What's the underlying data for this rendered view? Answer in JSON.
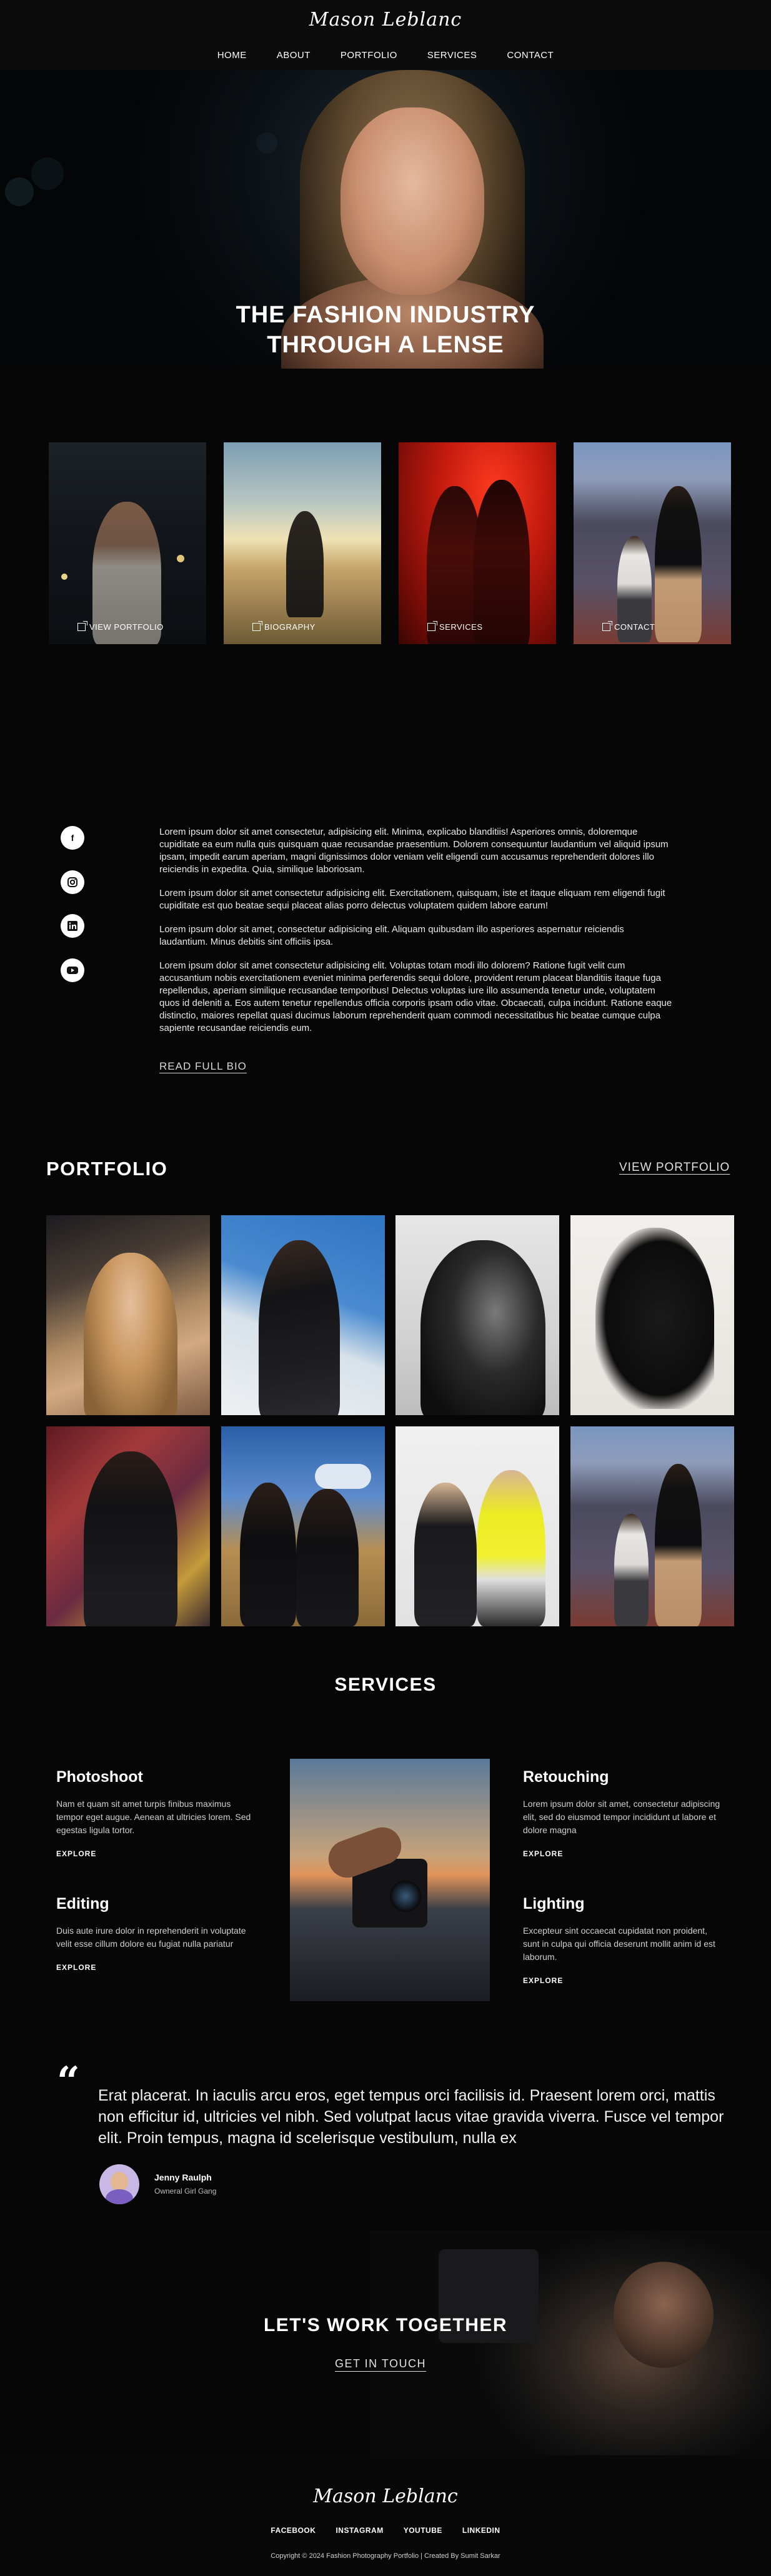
{
  "header": {
    "logo": "Mason Leblanc",
    "nav": [
      "HOME",
      "ABOUT",
      "PORTFOLIO",
      "SERVICES",
      "CONTACT"
    ]
  },
  "hero": {
    "title_line1": "THE FASHION INDUSTRY",
    "title_line2": "THROUGH A LENSE"
  },
  "cards": [
    {
      "label": "VIEW PORTFOLIO"
    },
    {
      "label": "BIOGRAPHY"
    },
    {
      "label": "SERVICES"
    },
    {
      "label": "CONTACT"
    }
  ],
  "bio": {
    "socials": [
      "facebook-icon",
      "instagram-icon",
      "linkedin-icon",
      "youtube-icon"
    ],
    "paragraphs": [
      "Lorem ipsum dolor sit amet consectetur, adipisicing elit. Minima, explicabo blanditiis! Asperiores omnis, doloremque cupiditate ea eum nulla quis quisquam quae recusandae praesentium. Dolorem consequuntur laudantium vel aliquid ipsum ipsam, impedit earum aperiam, magni dignissimos dolor veniam velit eligendi cum accusamus reprehenderit dolores illo reiciendis in expedita. Quia, similique laboriosam.",
      "Lorem ipsum dolor sit amet consectetur adipisicing elit. Exercitationem, quisquam, iste et itaque eliquam rem eligendi fugit cupiditate est quo beatae sequi placeat alias porro delectus voluptatem quidem labore earum!",
      "Lorem ipsum dolor sit amet, consectetur adipisicing elit. Aliquam quibusdam illo asperiores aspernatur reiciendis laudantium. Minus debitis sint officiis ipsa.",
      "Lorem ipsum dolor sit amet consectetur adipisicing elit. Voluptas totam modi illo dolorem? Ratione fugit velit cum accusantium nobis exercitationem eveniet minima perferendis sequi dolore, provident rerum placeat blanditiis itaque fuga repellendus, aperiam similique recusandae temporibus! Delectus voluptas iure illo assumenda tenetur unde, voluptatem quos id deleniti a. Eos autem tenetur repellendus officia corporis ipsam odio vitae. Obcaecati, culpa incidunt. Ratione eaque distinctio, maiores repellat quasi ducimus laborum reprehenderit quam commodi necessitatibus hic beatae cumque culpa sapiente recusandae reiciendis eum."
    ],
    "read_more": "READ FULL BIO"
  },
  "portfolio": {
    "title": "PORTFOLIO",
    "link": "VIEW PORTFOLIO"
  },
  "services": {
    "title": "SERVICES",
    "items": [
      {
        "name": "Photoshoot",
        "desc": "Nam et quam sit amet turpis finibus maximus tempor eget augue. Aenean at ultricies lorem. Sed egestas ligula tortor.",
        "cta": "EXPLORE"
      },
      {
        "name": "Retouching",
        "desc": "Lorem ipsum dolor sit amet, consectetur adipiscing elit, sed do eiusmod tempor incididunt ut labore et dolore magna",
        "cta": "EXPLORE"
      },
      {
        "name": "Editing",
        "desc": "Duis aute irure dolor in reprehenderit in voluptate velit esse cillum dolore eu fugiat nulla pariatur",
        "cta": "EXPLORE"
      },
      {
        "name": "Lighting",
        "desc": "Excepteur sint occaecat cupidatat non proident, sunt in culpa qui officia deserunt mollit anim id est laborum.",
        "cta": "EXPLORE"
      }
    ]
  },
  "testimonial": {
    "quote": "Erat placerat. In iaculis arcu eros, eget tempus orci facilisis id. Praesent lorem orci, mattis non efficitur id, ultricies vel nibh. Sed volutpat lacus vitae gravida viverra. Fusce vel tempor elit. Proin tempus, magna id scelerisque vestibulum, nulla ex",
    "name": "Jenny Raulph",
    "org": "Owneral Girl Gang"
  },
  "cta": {
    "title": "LET'S WORK TOGETHER",
    "link": "GET IN TOUCH"
  },
  "footer": {
    "logo": "Mason Leblanc",
    "links": [
      "FACEBOOK",
      "INSTAGRAM",
      "YOUTUBE",
      "LINKEDIN"
    ],
    "copyright": "Copyright © 2024 Fashion Photography Portfolio | Created By Sumit Sarkar"
  }
}
